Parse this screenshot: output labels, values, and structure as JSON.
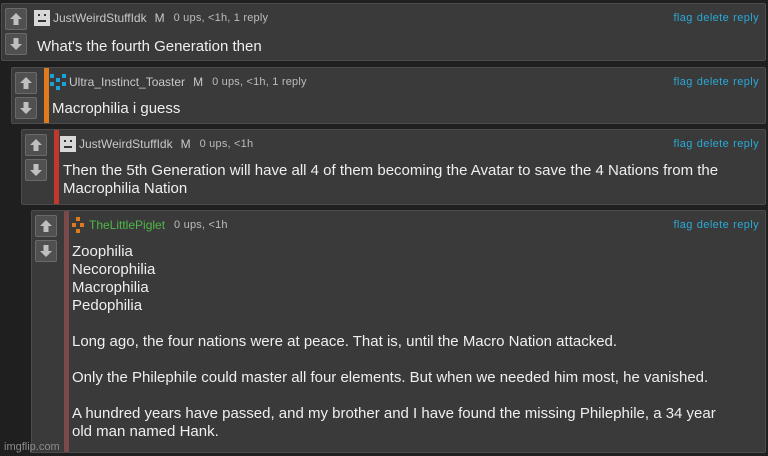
{
  "colors": {
    "background": "#1f1f1f",
    "panel": "#3a3a3a",
    "action_link": "#2aa9d6",
    "accent_orange": "#e07a1e",
    "accent_red": "#c0392b",
    "accent_muted_red": "#7a4a4a",
    "username_green": "#4fb848"
  },
  "comments": [
    {
      "username": "JustWeirdStuffIdk",
      "badge": "M",
      "meta": "0 ups, <1h, 1 reply",
      "actions": [
        "flag",
        "delete",
        "reply"
      ],
      "avatar_icon": "pixel-face-icon",
      "lines": [
        "What's the fourth Generation then"
      ]
    },
    {
      "username": "Ultra_Instinct_Toaster",
      "badge": "M",
      "meta": "0 ups, <1h, 1 reply",
      "actions": [
        "flag",
        "delete",
        "reply"
      ],
      "avatar_icon": "pixel-cyan-icon",
      "lines": [
        "Macrophilia i guess"
      ]
    },
    {
      "username": "JustWeirdStuffIdk",
      "badge": "M",
      "meta": "0 ups, <1h",
      "actions": [
        "flag",
        "delete",
        "reply"
      ],
      "avatar_icon": "pixel-face-icon",
      "lines": [
        "Then the 5th Generation will have all 4 of them becoming the Avatar to save the 4 Nations from the",
        "Macrophilia Nation"
      ]
    },
    {
      "username": "TheLittlePiglet",
      "meta": "0 ups, <1h",
      "actions": [
        "flag",
        "delete",
        "reply"
      ],
      "avatar_icon": "pixel-orange-icon",
      "lines": [
        "Zoophilia",
        "Necorophilia",
        "Macrophilia",
        "Pedophilia",
        "",
        "Long ago, the four nations were at peace. That is, until the Macro Nation attacked.",
        "",
        "Only the Philephile could master all four elements. But when we needed him most, he vanished.",
        "",
        "A hundred years have passed, and my brother and I have found the missing Philephile, a 34 year",
        "old man named Hank."
      ]
    }
  ],
  "watermark": "imgflip.com"
}
